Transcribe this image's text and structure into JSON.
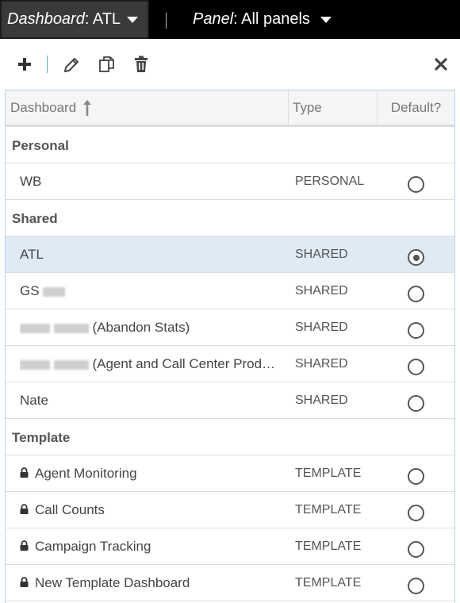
{
  "topbar": {
    "dashboard_prefix": "Dashboard",
    "dashboard_value": ": ATL",
    "panel_prefix": "Panel",
    "panel_value": ": All panels"
  },
  "toolbar": {
    "icons": [
      "plus-icon",
      "pencil-icon",
      "copy-icon",
      "trash-icon",
      "close-icon"
    ]
  },
  "table": {
    "columns": {
      "dashboard": "Dashboard",
      "type": "Type",
      "default": "Default?"
    },
    "sort": "ascending",
    "groups": {
      "personal": {
        "label": "Personal",
        "rows": [
          {
            "name": "WB",
            "type": "PERSONAL",
            "default": false
          }
        ]
      },
      "shared": {
        "label": "Shared",
        "rows": [
          {
            "name": "ATL",
            "type": "SHARED",
            "default": true
          },
          {
            "name": "GS",
            "type": "SHARED",
            "default": false
          },
          {
            "name": "(Abandon Stats)",
            "type": "SHARED",
            "default": false
          },
          {
            "name": "(Agent and Call Center Produ…",
            "type": "SHARED",
            "default": false
          },
          {
            "name": "Nate",
            "type": "SHARED",
            "default": false
          }
        ]
      },
      "template": {
        "label": "Template",
        "rows": [
          {
            "name": "Agent Monitoring",
            "type": "TEMPLATE",
            "default": false,
            "locked": true
          },
          {
            "name": "Call Counts",
            "type": "TEMPLATE",
            "default": false,
            "locked": true
          },
          {
            "name": "Campaign Tracking",
            "type": "TEMPLATE",
            "default": false,
            "locked": true
          },
          {
            "name": "New Template Dashboard",
            "type": "TEMPLATE",
            "default": false,
            "locked": true
          }
        ]
      }
    }
  },
  "colors": {
    "topbar_bg": "#000000",
    "selector_bg": "#3a3a3a",
    "selected_row": "#dfeaf5",
    "table_border": "#b8d3e3",
    "toolbar_divider": "#5aa9c8"
  }
}
